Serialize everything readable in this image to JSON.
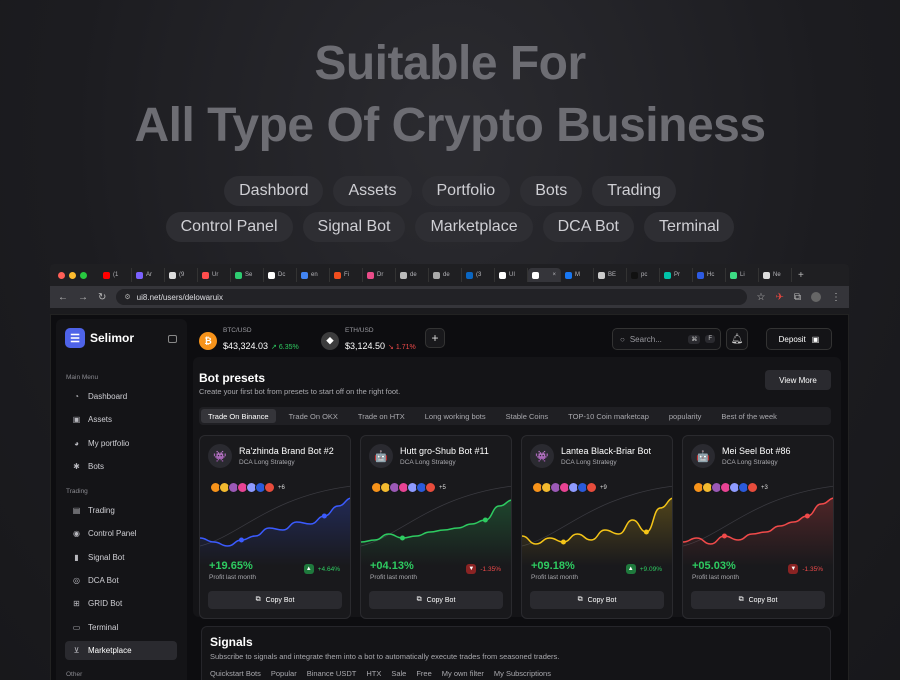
{
  "hero": {
    "line1": "Suitable For",
    "line2": "All Type Of Crypto Business",
    "chips_row1": [
      "Dashbord",
      "Assets",
      "Portfolio",
      "Bots",
      "Trading"
    ],
    "chips_row2": [
      "Control Panel",
      "Signal Bot",
      "Marketplace",
      "DCA Bot",
      "Terminal"
    ]
  },
  "browser": {
    "url": "ui8.net/users/delowaruix",
    "tabs": [
      {
        "label": "(1",
        "color": "#ff0000"
      },
      {
        "label": "Ar",
        "color": "#7b61ff"
      },
      {
        "label": "(9",
        "color": "#dddddd"
      },
      {
        "label": "Ur",
        "color": "#ff4d4d"
      },
      {
        "label": "Se",
        "color": "#2ecc71"
      },
      {
        "label": "Dc",
        "color": "#ffffff"
      },
      {
        "label": "en",
        "color": "#4285f4"
      },
      {
        "label": "Fi",
        "color": "#f24e1e"
      },
      {
        "label": "Dr",
        "color": "#ea4c89"
      },
      {
        "label": "de",
        "color": "#bbbbbb"
      },
      {
        "label": "de",
        "color": "#aaaaaa"
      },
      {
        "label": "(3",
        "color": "#0a66c2"
      },
      {
        "label": "UI",
        "color": "#ffffff"
      },
      {
        "label": "",
        "color": "#ffffff",
        "active": true
      },
      {
        "label": "M",
        "color": "#1877f2"
      },
      {
        "label": "BE",
        "color": "#cccccc"
      },
      {
        "label": "pc",
        "color": "#111111"
      },
      {
        "label": "Pr",
        "color": "#00c2a8"
      },
      {
        "label": "Hc",
        "color": "#2d5be3"
      },
      {
        "label": "Li",
        "color": "#3ddc84"
      },
      {
        "label": "Ne",
        "color": "#dddddd"
      }
    ]
  },
  "app": {
    "brand": "Selimor",
    "sidebar": {
      "main_label": "Main Menu",
      "main_items": [
        {
          "label": "Dashboard",
          "icon": "dashboard-icon",
          "glyph": "◔"
        },
        {
          "label": "Assets",
          "icon": "assets-icon",
          "glyph": "▣"
        },
        {
          "label": "My portfolio",
          "icon": "portfolio-icon",
          "glyph": "◕"
        },
        {
          "label": "Bots",
          "icon": "bot-icon",
          "glyph": "✱"
        }
      ],
      "trading_label": "Trading",
      "trading_items": [
        {
          "label": "Trading",
          "icon": "chat-icon",
          "glyph": "▤"
        },
        {
          "label": "Control Panel",
          "icon": "compass-icon",
          "glyph": "◉"
        },
        {
          "label": "Signal Bot",
          "icon": "signal-icon",
          "glyph": "▮"
        },
        {
          "label": "DCA Bot",
          "icon": "dca-icon",
          "glyph": "◎"
        },
        {
          "label": "GRID Bot",
          "icon": "grid-icon",
          "glyph": "⊞"
        },
        {
          "label": "Terminal",
          "icon": "terminal-icon",
          "glyph": "▭"
        },
        {
          "label": "Marketplace",
          "icon": "cart-icon",
          "glyph": "⊻",
          "active": true
        }
      ],
      "other_label": "Other"
    },
    "topbar": {
      "btc": {
        "pair": "BTC/USD",
        "price": "$43,324.03",
        "change": "6.35%",
        "dir": "up",
        "color": "#f7931a",
        "symbol": "₿"
      },
      "eth": {
        "pair": "ETH/USD",
        "price": "$3,124.50",
        "change": "1.71%",
        "dir": "down",
        "color": "#3c3c3d",
        "symbol": "◆"
      },
      "search_placeholder": "Search...",
      "kbd1": "⌘",
      "kbd2": "F",
      "deposit": "Deposit"
    },
    "presets": {
      "title": "Bot presets",
      "subtitle": "Create your first bot from presets to start off on the right foot.",
      "view_more": "View More",
      "tabs": [
        "Trade On Binance",
        "Trade On OKX",
        "Trade on HTX",
        "Long working bots",
        "Stable Coins",
        "TOP-10 Coin marketcap",
        "popularity",
        "Best of the week"
      ],
      "cards": [
        {
          "name": "Ra'zhinda Brand Bot #2",
          "strategy": "DCA Long Strategy",
          "more": "+6",
          "profit": "+19.65%",
          "profit_label": "Profit last month",
          "badge": "+4.64%",
          "badge_dir": "up",
          "line_color": "#3b5bff",
          "avatar": "👾",
          "points": [
            62,
            66,
            70,
            64,
            60,
            52,
            54,
            46,
            48,
            40,
            30,
            22
          ]
        },
        {
          "name": "Hutt gro-Shub Bot #11",
          "strategy": "DCA Long Strategy",
          "more": "+5",
          "profit": "+04.13%",
          "profit_label": "Profit last month",
          "badge": "-1.35%",
          "badge_dir": "down",
          "line_color": "#2ecb61",
          "avatar": "🤖",
          "points": [
            66,
            64,
            58,
            62,
            60,
            56,
            54,
            52,
            48,
            44,
            30,
            24
          ]
        },
        {
          "name": "Lantea Black-Briar Bot",
          "strategy": "DCA Long Strategy",
          "more": "+9",
          "profit": "+09.18%",
          "profit_label": "Profit last month",
          "badge": "+9.09%",
          "badge_dir": "up",
          "line_color": "#f5c518",
          "avatar": "👾",
          "points": [
            60,
            68,
            62,
            66,
            58,
            64,
            54,
            58,
            44,
            56,
            32,
            22
          ]
        },
        {
          "name": "Mei Seel Bot #86",
          "strategy": "DCA Long Strategy",
          "more": "+3",
          "profit": "+05.03%",
          "profit_label": "Profit last month",
          "badge": "-1.35%",
          "badge_dir": "down",
          "line_color": "#f04a4a",
          "avatar": "🤖",
          "points": [
            66,
            62,
            68,
            60,
            64,
            58,
            56,
            50,
            46,
            40,
            28,
            22
          ]
        }
      ],
      "copy_label": "Copy Bot"
    },
    "signals": {
      "title": "Signals",
      "subtitle": "Subscribe to signals and integrate them into a bot to automatically execute trades from seasoned traders.",
      "tabs": [
        "Quickstart Bots",
        "Popular",
        "Binance USDT",
        "HTX",
        "Sale",
        "Free",
        "My own filter",
        "My Subscriptions"
      ]
    }
  },
  "colors": {
    "accent": "#4e63e8",
    "up": "#2ecb61",
    "down": "#f04a4a"
  }
}
